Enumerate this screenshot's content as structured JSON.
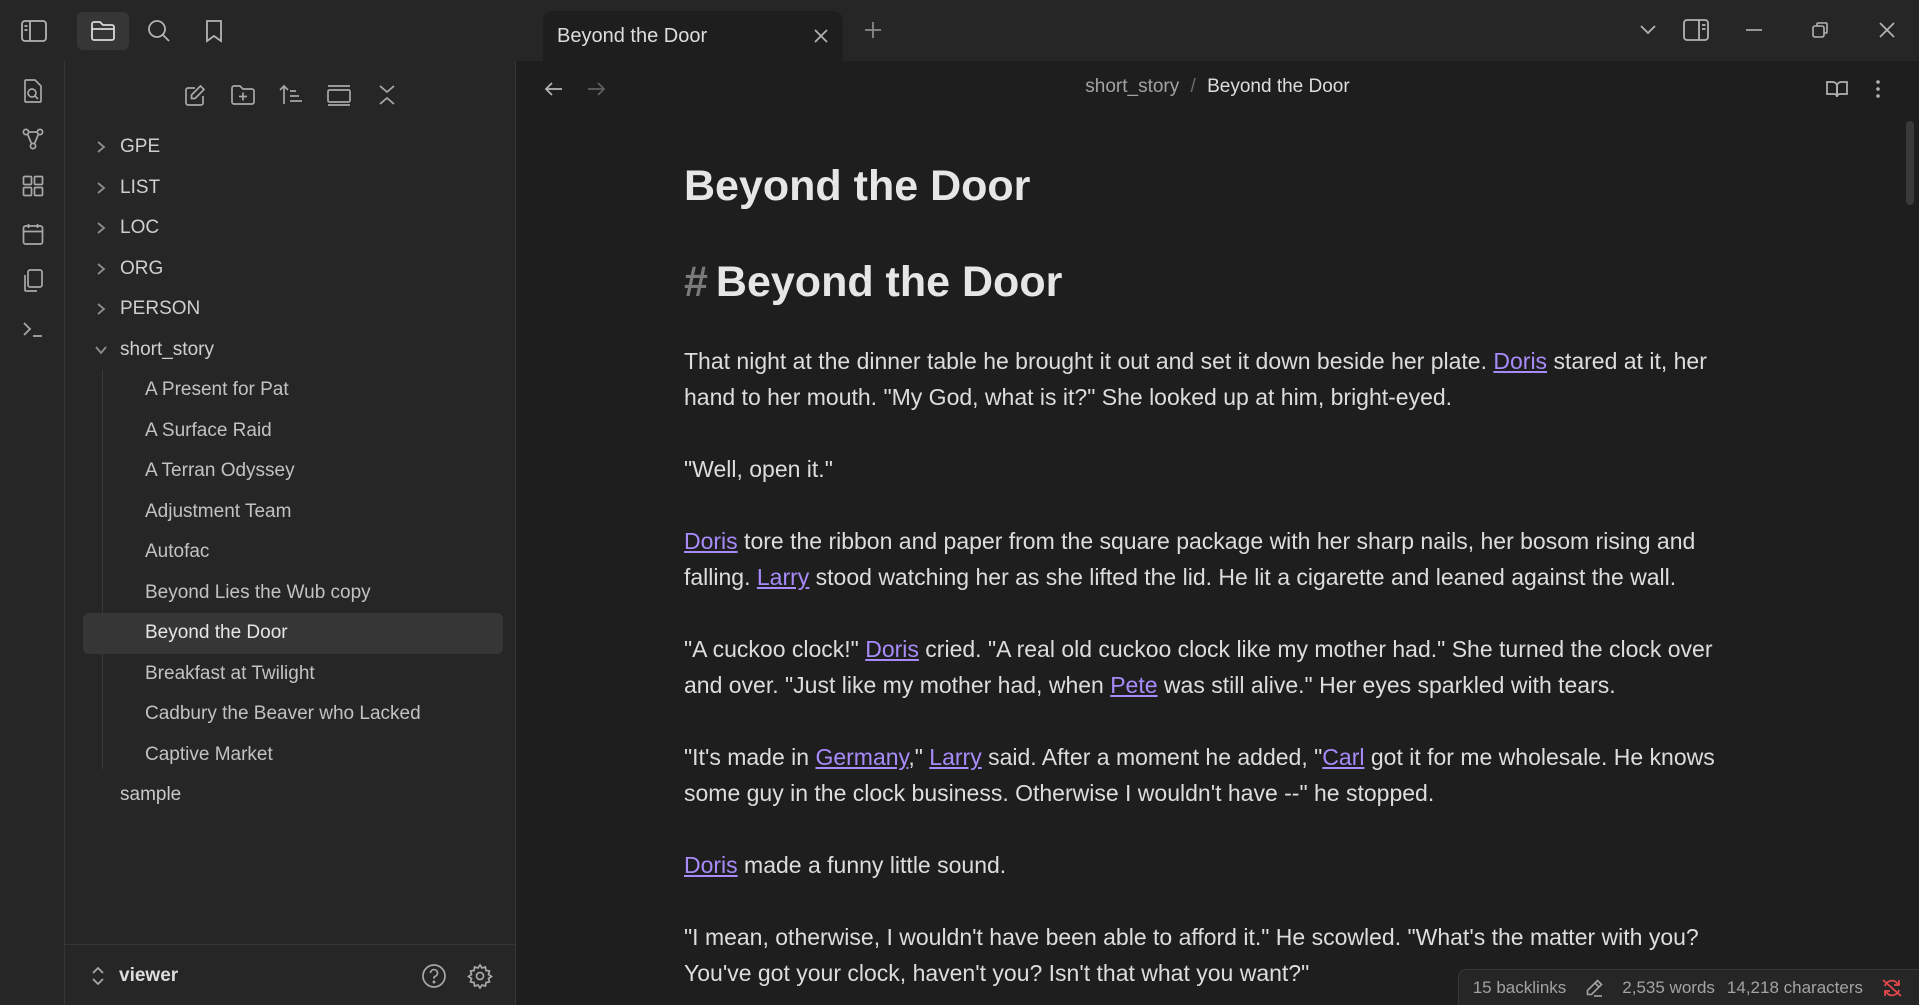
{
  "titlebar": {
    "tab_title": "Beyond the Door"
  },
  "sidebar": {
    "folders_top": [
      {
        "label": "GPE"
      },
      {
        "label": "LIST"
      },
      {
        "label": "LOC"
      },
      {
        "label": "ORG"
      },
      {
        "label": "PERSON"
      }
    ],
    "open_folder": {
      "label": "short_story",
      "files": [
        {
          "label": "A Present for Pat"
        },
        {
          "label": "A Surface Raid"
        },
        {
          "label": "A Terran Odyssey"
        },
        {
          "label": "Adjustment Team"
        },
        {
          "label": "Autofac"
        },
        {
          "label": "Beyond Lies the Wub copy"
        },
        {
          "label": "Beyond the Door"
        },
        {
          "label": "Breakfast at Twilight"
        },
        {
          "label": "Cadbury the Beaver who Lacked"
        },
        {
          "label": "Captive Market"
        }
      ]
    },
    "root_file": "sample",
    "vault_name": "viewer"
  },
  "editor": {
    "breadcrumb": {
      "folder": "short_story",
      "separator": "/",
      "current": "Beyond the Door"
    },
    "inline_title": "Beyond the Door",
    "heading_hash": "#",
    "heading": "Beyond the Door",
    "p1": {
      "a": "That night at the dinner table he brought it out and set it down beside her plate. ",
      "link1": "Doris",
      "b": " stared at it, her hand to her mouth. \"My God, what is it?\" She looked up at him, bright-eyed."
    },
    "p2": "\"Well, open it.\"",
    "p3": {
      "link1": "Doris",
      "a": " tore the ribbon and paper from the square package with her sharp nails, her bosom rising and falling. ",
      "link2": "Larry",
      "b": " stood watching her as she lifted the lid. He lit a cigarette and leaned against the wall."
    },
    "p4": {
      "a": "\"A cuckoo clock!\" ",
      "link1": "Doris",
      "b": " cried. \"A real old cuckoo clock like my mother had.\" She turned the clock over and over. \"Just like my mother had, when ",
      "link2": "Pete",
      "c": " was still alive.\" Her eyes sparkled with tears."
    },
    "p5": {
      "a": "\"It's made in ",
      "link1": "Germany",
      "b": ",\" ",
      "link2": "Larry",
      "c": " said. After a moment he added, \"",
      "link3": "Carl",
      "d": " got it for me wholesale. He knows some guy in the clock business. Otherwise I wouldn't have --\" he stopped."
    },
    "p6": {
      "link1": "Doris",
      "a": " made a funny little sound."
    },
    "p7": "\"I mean, otherwise, I wouldn't have been able to afford it.\" He scowled. \"What's the matter with you? You've got your clock, haven't you? Isn't that what you want?\""
  },
  "status_bar": {
    "backlinks": "15 backlinks",
    "words": "2,535 words",
    "characters": "14,218 characters"
  },
  "colors": {
    "accent_link": "#a88bfa",
    "sync_error": "#e5484d"
  }
}
